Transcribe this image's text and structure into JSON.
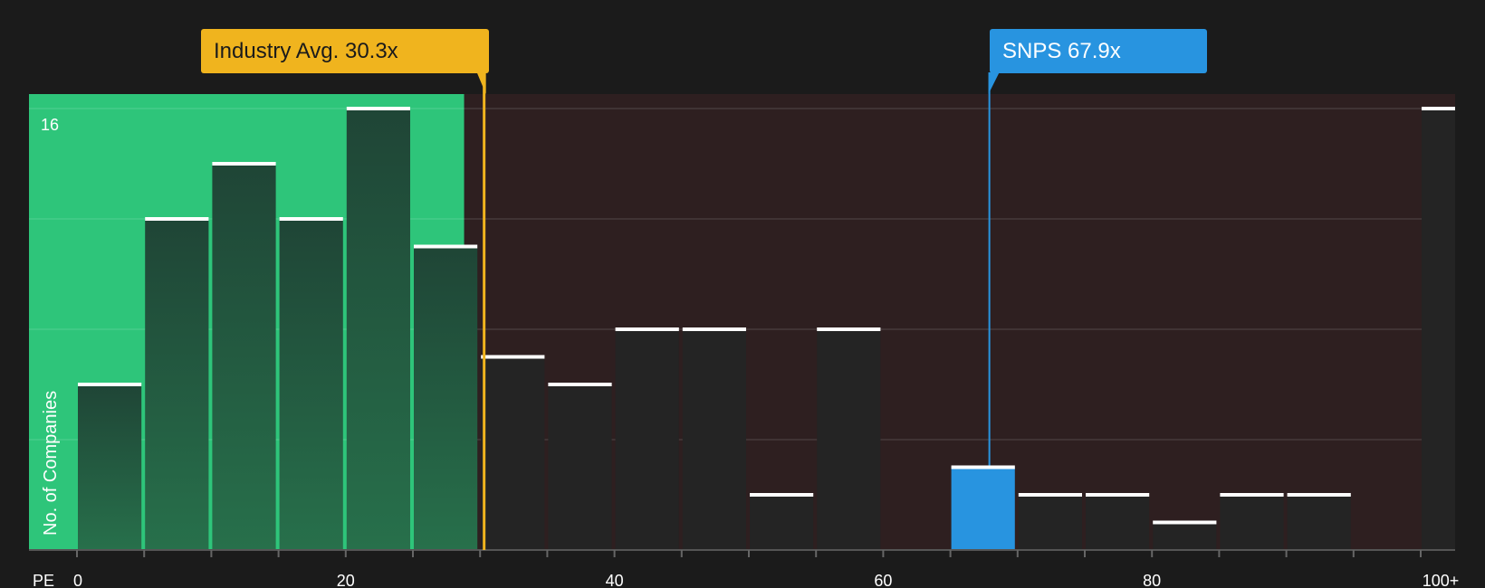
{
  "chart_data": {
    "type": "bar",
    "xlabel": "PE",
    "ylabel": "No. of Companies",
    "xlim": [
      0,
      100
    ],
    "ylim": [
      0,
      16
    ],
    "x_ticks": [
      "0",
      "20",
      "40",
      "60",
      "80",
      "100+"
    ],
    "y_tick_label": "16",
    "bin_width": 5,
    "bins": [
      {
        "x0": 0,
        "x1": 5,
        "count": 6
      },
      {
        "x0": 5,
        "x1": 10,
        "count": 12
      },
      {
        "x0": 10,
        "x1": 15,
        "count": 14
      },
      {
        "x0": 15,
        "x1": 20,
        "count": 12
      },
      {
        "x0": 20,
        "x1": 25,
        "count": 16
      },
      {
        "x0": 25,
        "x1": 30,
        "count": 11
      },
      {
        "x0": 30,
        "x1": 35,
        "count": 7
      },
      {
        "x0": 35,
        "x1": 40,
        "count": 6
      },
      {
        "x0": 40,
        "x1": 45,
        "count": 8
      },
      {
        "x0": 45,
        "x1": 50,
        "count": 8
      },
      {
        "x0": 50,
        "x1": 55,
        "count": 2
      },
      {
        "x0": 55,
        "x1": 60,
        "count": 8
      },
      {
        "x0": 65,
        "x1": 70,
        "count": 3
      },
      {
        "x0": 70,
        "x1": 75,
        "count": 2
      },
      {
        "x0": 75,
        "x1": 80,
        "count": 2
      },
      {
        "x0": 80,
        "x1": 85,
        "count": 1
      },
      {
        "x0": 85,
        "x1": 90,
        "count": 2
      },
      {
        "x0": 90,
        "x1": 95,
        "count": 2
      },
      {
        "x0": 100,
        "x1": 105,
        "count": 16,
        "tick_label": "100+"
      }
    ],
    "highlight_bin_x0": 65,
    "industry_avg": {
      "value": 30.3,
      "label": "Industry Avg. 30.3x"
    },
    "company": {
      "ticker": "SNPS",
      "value": 67.9,
      "label": "SNPS 67.9x"
    },
    "grid": true,
    "colors": {
      "background": "#1b1b1b",
      "below_avg_region": "#2ec57a",
      "above_avg_region": "#2e1f20",
      "bar_fill": "#242424",
      "bar_top": "#ffffff",
      "industry_avg": "#f0b41e",
      "company": "#2894e0"
    }
  }
}
